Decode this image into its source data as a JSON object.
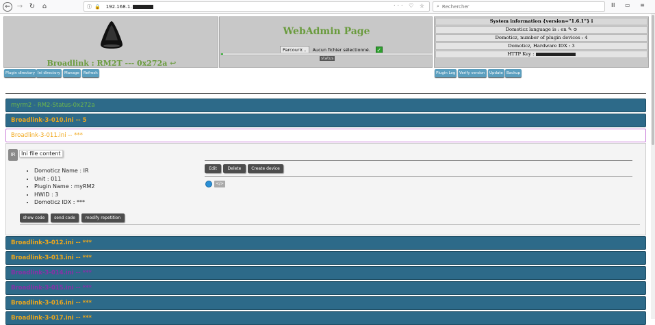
{
  "browser": {
    "url": "192.168.1.",
    "search_placeholder": "Rechercher",
    "back": "←",
    "forward": "→",
    "reload": "↻",
    "home": "⌂",
    "url_actions": "··· ♡ ☆",
    "right_icons": "Ⅲ ▭ ≡"
  },
  "header": {
    "device_title": "Broadlink : RM2T --- 0x272a ↩",
    "webadmin_title": "WebAdmin Page",
    "browse_label": "Parcourir...",
    "no_file_label": "Aucun fichier sélectionné.",
    "check_mark": "✓",
    "status_label": "status",
    "upload_progress_pct": 1,
    "sysinfo": {
      "title": "System information {version=\"1.6.1\"} i",
      "language": "Domoticz language is : en ✎ ⊙",
      "plugin_devices": "Domoticz, number of plugin devices : 4",
      "hardware_idx": "Domoticz, Hardware IDX : 3",
      "http_key": "HTTP Key :"
    }
  },
  "toolbar_left": [
    "Plugin directory",
    "Ini directory",
    "Manage",
    "Refresh"
  ],
  "toolbar_right": [
    "Plugin Log",
    "Verify version",
    "Update",
    "Backup"
  ],
  "sections": [
    {
      "label": "myrm2 - RM2-Status-0x272a"
    },
    {
      "label": "Broadlink-3-010.ini -- 5"
    },
    {
      "label": "Broadlink-3-011.ini -- ***"
    },
    {
      "label": "Broadlink-3-012.ini -- ***"
    },
    {
      "label": "Broadlink-3-013.ini -- ***"
    },
    {
      "label": "Broadlink-3-014.ini -- ***"
    },
    {
      "label": "Broadlink-3-015.ini -- ***"
    },
    {
      "label": "Broadlink-3-016.ini -- ***"
    },
    {
      "label": "Broadlink-3-017.ini -- ***"
    }
  ],
  "ini_content": {
    "badge": "IR",
    "label": "Ini file content",
    "items": [
      "Domoticz Name : IR",
      "Unit : 011",
      "Plugin Name : myRM2",
      "HWID : 3",
      "Domoticz IDX : ***"
    ],
    "buttons": {
      "show_code": "show code",
      "send_code": "send code",
      "modify_repetition": "modify repetition"
    },
    "actions": {
      "edit": "Edit",
      "delete": "Delete",
      "create_device": "Create device"
    },
    "code_icon": "</>"
  }
}
